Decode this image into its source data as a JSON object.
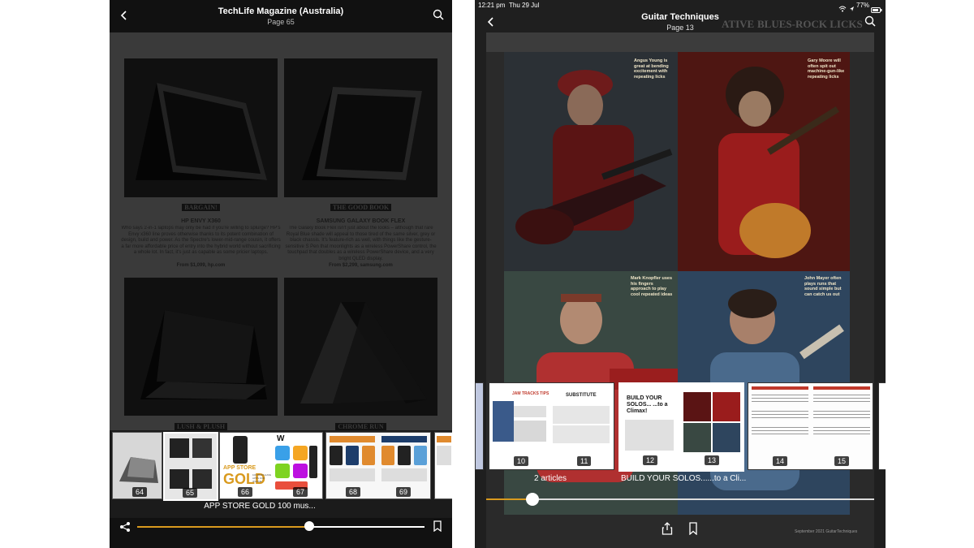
{
  "left": {
    "title": "TechLife Magazine (Australia)",
    "subtitle": "Page 65",
    "page": {
      "products": [
        {
          "banner": "BARGAIN!",
          "name": "HP ENVY X360",
          "body": "Who says 2-in-1 laptops may only be had if you're willing to splurge? HP's Envy x360 line proves otherwise thanks to its potent combination of design, build and power. As the Spectre's lower-mid-range cousin, it offers a far more affordable price of entry into the hybrid world without sacrificing a whole lot. In fact, it's just as capable as some pricier laptops.",
          "price": "From $1,099, hp.com"
        },
        {
          "banner": "THE GOOD BOOK",
          "name": "SAMSUNG GALAXY BOOK FLEX",
          "body": "The Galaxy Book Flex isn't just about the looks – although that rare Royal Blue shade will appeal to those tired of the same silver, grey or black chassis. It's feature-rich as well, with things like the gesture-sensitive S Pen that moonlights as a wireless PowerShare control, the touchpad that doubles as a wireless PowerShare device, and a very bright QLED display.",
          "price": "From $2,299, samsung.com"
        }
      ],
      "lower_banners": [
        "LUSH & PLUSH",
        "CHROME RUN"
      ]
    },
    "thumbnails": [
      {
        "num": "64"
      },
      {
        "num": "65"
      },
      {
        "num": "66"
      },
      {
        "num": "67"
      },
      {
        "num": "68"
      },
      {
        "num": "69"
      }
    ],
    "thumb_text": {
      "app_store": "APP STORE",
      "gold": "GOLD",
      "gold_sub": "100 MUST-HAVE APPS FOR IPHONE",
      "w": "W"
    },
    "caption": "APP STORE GOLD 100 mus...",
    "progress": 0.6
  },
  "right": {
    "status_time": "12:21 pm",
    "status_date": "Thu 29 Jul",
    "battery": "77%",
    "title": "Guitar Techniques",
    "subtitle": "Page 13",
    "header_text": "BLUES-ROCK LICKS",
    "header_left": "ATIVE",
    "notes": [
      "Angus Young is great at bending excitement with repeating licks",
      "Gary Moore will often spit out machine-gun-like repeating licks",
      "Mark Knopfler uses his fingers approach to play cool repeated ideas",
      "John Mayer often plays runs that sound simple but can catch us out"
    ],
    "thumbnails": [
      {
        "num": "10"
      },
      {
        "num": "11"
      },
      {
        "num": "12"
      },
      {
        "num": "13"
      },
      {
        "num": "14"
      },
      {
        "num": "15"
      }
    ],
    "thumb_text": {
      "jam": "JAM TRACKS TIPS",
      "substitute": "SUBSTITUTE",
      "build": "BUILD YOUR SOLOS... ...to a Climax!"
    },
    "captions": [
      "2 articles",
      "BUILD YOUR SOLOS......to a Cli..."
    ],
    "progress": 0.12,
    "footer": "September 2021 GuitarTechniques"
  },
  "colors": {
    "accent": "#d99a1e"
  }
}
